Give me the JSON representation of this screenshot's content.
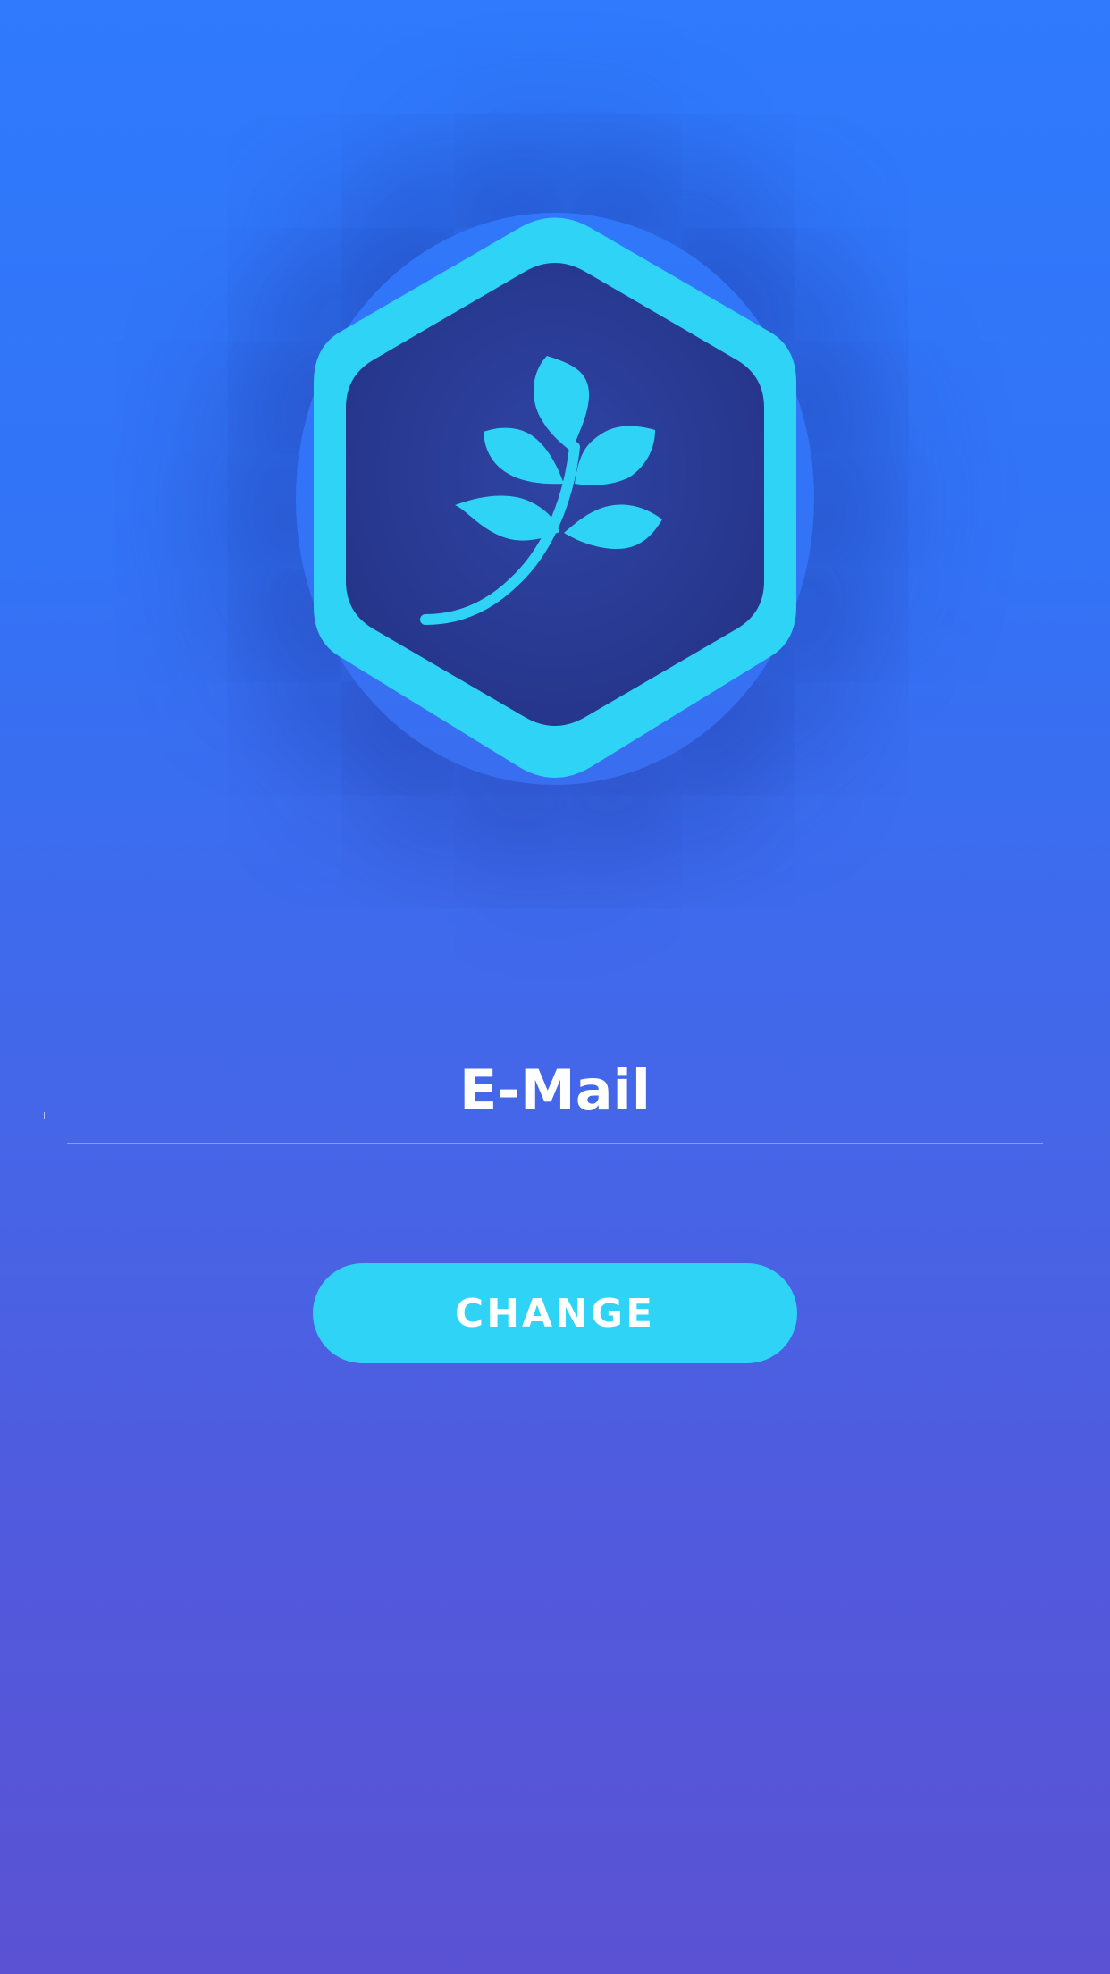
{
  "logo": {
    "icon": "leaf-branch-icon",
    "frame_shape": "hexagon",
    "frame_color": "#2fd3f6",
    "inner_color": "#283a96",
    "leaf_color": "#2fd3f6"
  },
  "email_field": {
    "value": "",
    "placeholder": "E-Mail"
  },
  "change_button": {
    "label": "CHANGE"
  },
  "colors": {
    "background_top": "#2f7afd",
    "background_bottom": "#5b52d3",
    "accent": "#2fd3f6",
    "text": "#ffffff"
  }
}
